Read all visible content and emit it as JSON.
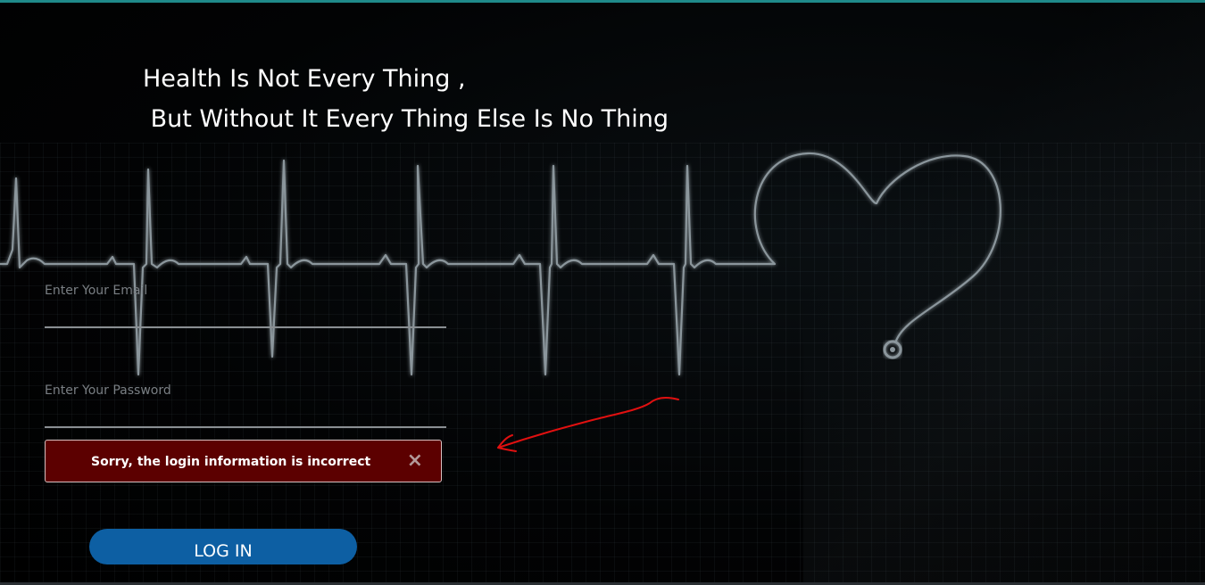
{
  "quote": {
    "line1": "Health Is Not Every Thing ,",
    "line2": " But Without It Every Thing Else Is No Thing"
  },
  "form": {
    "email_label": "Enter Your Email",
    "email_value": "",
    "password_label": "Enter Your Password",
    "password_value": ""
  },
  "alert": {
    "message": "Sorry, the login information is incorrect",
    "close_glyph": "×",
    "color": "#5c0000"
  },
  "login_button": {
    "label": "LOG IN",
    "color": "#0d5fa3"
  },
  "decorations": {
    "background_icon": "heartbeat-heart-stethoscope",
    "annotation_icon": "red-hand-drawn-arrow-icon",
    "annotation_color": "#e01010"
  }
}
